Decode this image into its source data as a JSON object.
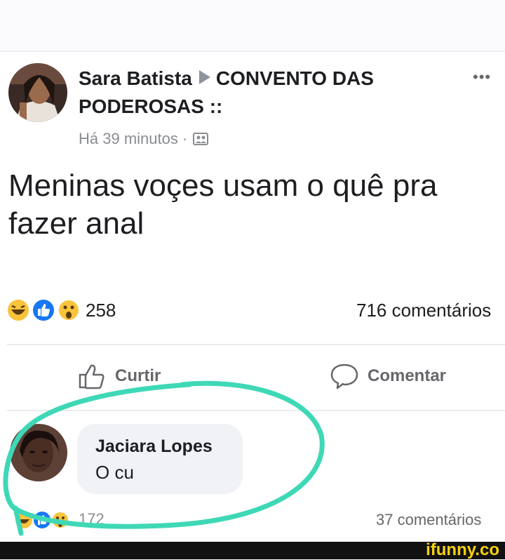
{
  "post": {
    "author": "Sara Batista",
    "group": "CONVENTO DAS PODEROSAS ::",
    "timestamp": "Há 39 minutos ·",
    "text_line1": "Meninas voçes usam  o quê pra",
    "text_line2": "fazer anal",
    "reactions_count": "258",
    "reaction_icons": [
      "haha-icon",
      "like-icon",
      "wow-icon"
    ],
    "comments_count": "716 comentários"
  },
  "actions": {
    "like_label": "Curtir",
    "comment_label": "Comentar"
  },
  "comment": {
    "author": "Jaciara Lopes",
    "text": "O cu",
    "reactions_count": "172",
    "comments_count": "37 comentários"
  },
  "highlight": {
    "color": "#3fd8b6"
  },
  "watermark": {
    "text": "ifunny.co",
    "color": "#f5d20c"
  }
}
